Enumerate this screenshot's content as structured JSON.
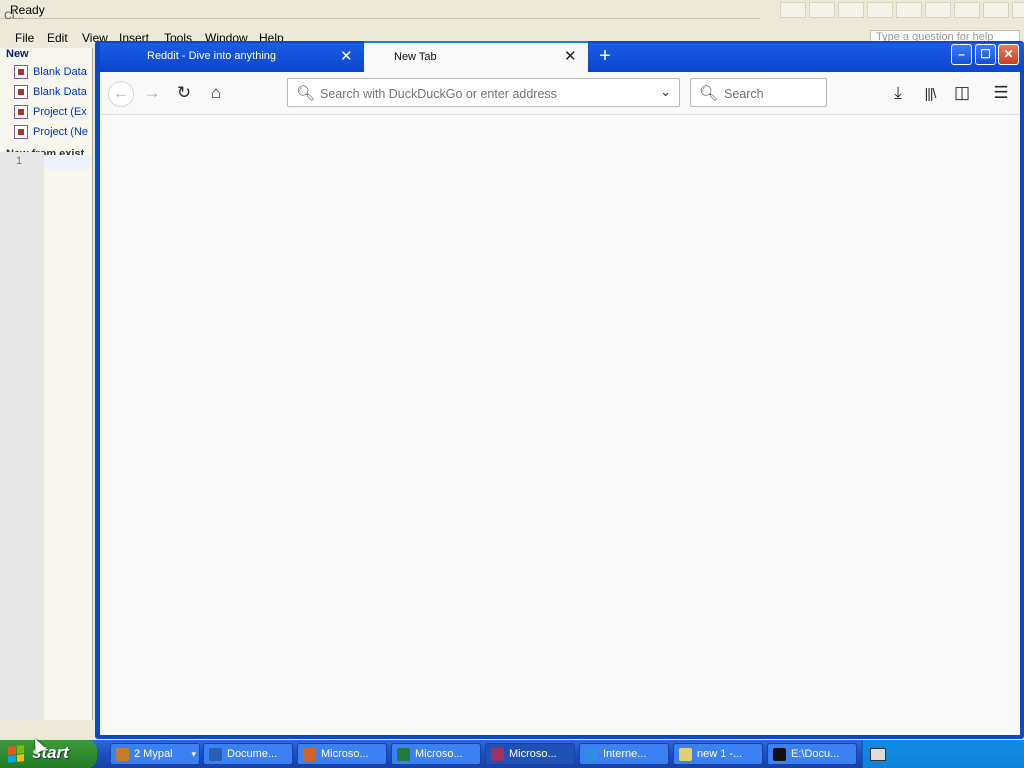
{
  "background_app": {
    "status_text": "Ready",
    "title_partial": "Cl...",
    "menus": [
      "File",
      "Edit",
      "View",
      "Insert",
      "Tools",
      "Window",
      "Help"
    ],
    "help_placeholder": "Type a question for help",
    "task_pane": {
      "new_label": "New",
      "items": [
        "Blank Data",
        "Blank Data",
        "Project (Ex",
        "Project (Ne"
      ],
      "new_from_label": "New from exist"
    },
    "line_number": "1"
  },
  "firefox": {
    "tabs": [
      {
        "label": "Reddit - Dive into anything",
        "active": false
      },
      {
        "label": "New Tab",
        "active": true
      }
    ],
    "url_placeholder": "Search with DuckDuckGo or enter address",
    "search_placeholder": "Search",
    "window_buttons": [
      "minimize",
      "maximize",
      "close"
    ]
  },
  "taskbar": {
    "start_label": "start",
    "items": [
      {
        "label": "2 Mypal",
        "icon": "mypal-icon",
        "color": "#c77a2a"
      },
      {
        "label": "Docume...",
        "icon": "word-icon",
        "color": "#2b5fb4"
      },
      {
        "label": "Microso...",
        "icon": "powerpoint-icon",
        "color": "#d0642a"
      },
      {
        "label": "Microso...",
        "icon": "excel-icon",
        "color": "#1f7a3c"
      },
      {
        "label": "Microso...",
        "icon": "access-icon",
        "color": "#a03060"
      },
      {
        "label": "Interne...",
        "icon": "ie-icon",
        "color": "#2f8fe0"
      },
      {
        "label": "new 1 -...",
        "icon": "notepad-icon",
        "color": "#e0d070"
      },
      {
        "label": "E:\\Docu...",
        "icon": "cmd-icon",
        "color": "#111111"
      }
    ]
  },
  "colors": {
    "accent": "#0a84ff",
    "taskbar": "#245edb",
    "start": "#2f8c2f"
  }
}
